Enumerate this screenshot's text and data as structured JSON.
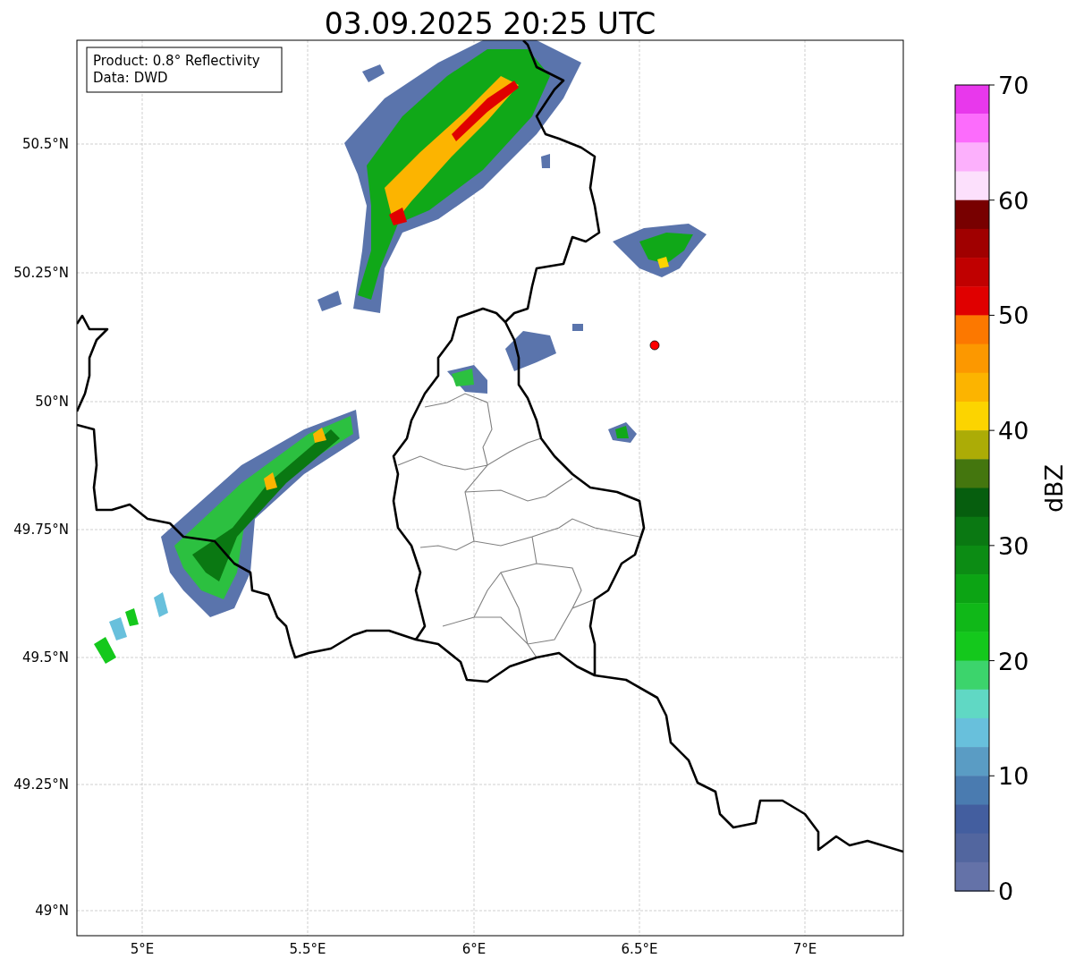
{
  "title": "03.09.2025 20:25 UTC",
  "info_box": [
    "Product: 0.8° Reflectivity",
    "Data: DWD"
  ],
  "y_ticks": [
    "50.5°N",
    "50.25°N",
    "50°N",
    "49.75°N",
    "49.5°N",
    "49.25°N",
    "49°N"
  ],
  "x_ticks": [
    "5°E",
    "5.5°E",
    "6°E",
    "6.5°E",
    "7°E"
  ],
  "colorbar": {
    "label": "dBZ",
    "ticks": [
      "70",
      "60",
      "50",
      "40",
      "30",
      "20",
      "10",
      "0"
    ],
    "bins": [
      {
        "color": "#e838ec"
      },
      {
        "color": "#fc6cfc"
      },
      {
        "color": "#fcb0fc"
      },
      {
        "color": "#fce0fc"
      },
      {
        "color": "#780000"
      },
      {
        "color": "#a00000"
      },
      {
        "color": "#c00000"
      },
      {
        "color": "#e00000"
      },
      {
        "color": "#fc7800"
      },
      {
        "color": "#fc9800"
      },
      {
        "color": "#fcb400"
      },
      {
        "color": "#fcd400"
      },
      {
        "color": "#acac06"
      },
      {
        "color": "#44760e"
      },
      {
        "color": "#065e0e"
      },
      {
        "color": "#0a7812"
      },
      {
        "color": "#0c8c14"
      },
      {
        "color": "#0ca414"
      },
      {
        "color": "#10b818"
      },
      {
        "color": "#14c81c"
      },
      {
        "color": "#3cd46c"
      },
      {
        "color": "#60d8c4"
      },
      {
        "color": "#68c0dc"
      },
      {
        "color": "#5a9cc4"
      },
      {
        "color": "#4a7bb0"
      },
      {
        "color": "#435e9f"
      },
      {
        "color": "#52669f"
      },
      {
        "color": "#6472a8"
      }
    ]
  }
}
